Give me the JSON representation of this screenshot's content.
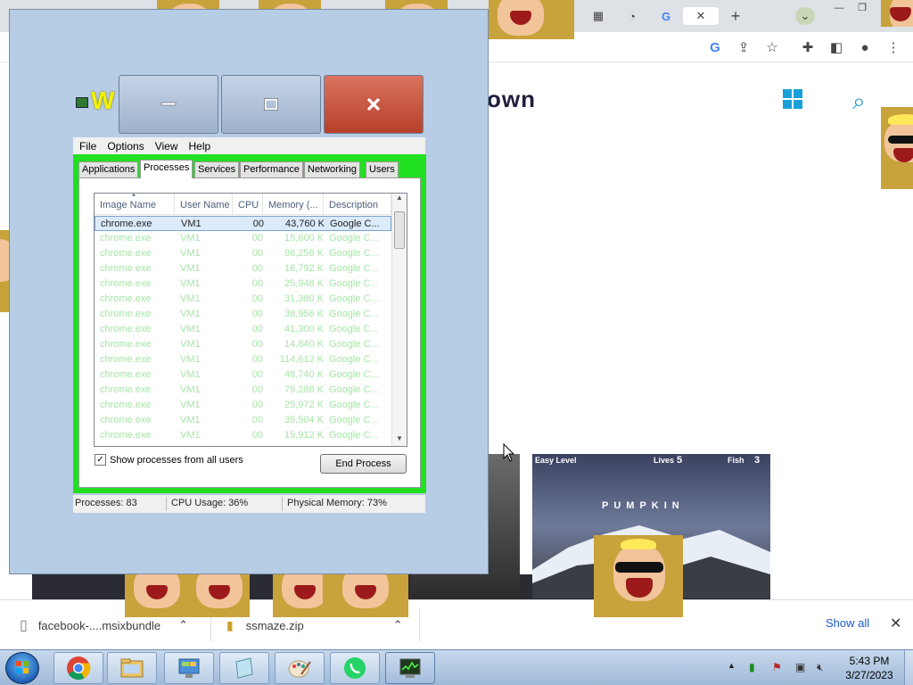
{
  "browser": {
    "site_brand": "own",
    "downloads": {
      "items": [
        {
          "name": "facebook-....msixbundle"
        },
        {
          "name": "ssmaze.zip"
        }
      ],
      "show_all": "Show all"
    },
    "game": {
      "level_label": "Easy  Level",
      "lives_label": "Lives",
      "lives_value": "5",
      "fish_label": "Fish",
      "fish_value": "3",
      "word": "PUMPKIN"
    }
  },
  "task_manager": {
    "title": "W",
    "menu": [
      "File",
      "Options",
      "View",
      "Help"
    ],
    "tabs": [
      "Applications",
      "Processes",
      "Services",
      "Performance",
      "Networking",
      "Users"
    ],
    "active_tab": "Processes",
    "columns": [
      "Image Name",
      "User Name",
      "CPU",
      "Memory (...",
      "Description"
    ],
    "rows": [
      {
        "image": "chrome.exe",
        "user": "VM1",
        "cpu": "00",
        "memory": "43,760 K",
        "desc": "Google C..."
      },
      {
        "image": "chrome.exe",
        "user": "VM1",
        "cpu": "00",
        "memory": "15,600 K",
        "desc": "Google C..."
      },
      {
        "image": "chrome.exe",
        "user": "VM1",
        "cpu": "00",
        "memory": "86,256 K",
        "desc": "Google C..."
      },
      {
        "image": "chrome.exe",
        "user": "VM1",
        "cpu": "00",
        "memory": "16,792 K",
        "desc": "Google C..."
      },
      {
        "image": "chrome.exe",
        "user": "VM1",
        "cpu": "00",
        "memory": "25,948 K",
        "desc": "Google C..."
      },
      {
        "image": "chrome.exe",
        "user": "VM1",
        "cpu": "00",
        "memory": "31,380 K",
        "desc": "Google C..."
      },
      {
        "image": "chrome.exe",
        "user": "VM1",
        "cpu": "00",
        "memory": "38,956 K",
        "desc": "Google C..."
      },
      {
        "image": "chrome.exe",
        "user": "VM1",
        "cpu": "00",
        "memory": "41,300 K",
        "desc": "Google C..."
      },
      {
        "image": "chrome.exe",
        "user": "VM1",
        "cpu": "00",
        "memory": "14,840 K",
        "desc": "Google C..."
      },
      {
        "image": "chrome.exe",
        "user": "VM1",
        "cpu": "00",
        "memory": "114,612 K",
        "desc": "Google C..."
      },
      {
        "image": "chrome.exe",
        "user": "VM1",
        "cpu": "00",
        "memory": "48,740 K",
        "desc": "Google C..."
      },
      {
        "image": "chrome.exe",
        "user": "VM1",
        "cpu": "00",
        "memory": "79,288 K",
        "desc": "Google C..."
      },
      {
        "image": "chrome.exe",
        "user": "VM1",
        "cpu": "00",
        "memory": "25,972 K",
        "desc": "Google C..."
      },
      {
        "image": "chrome.exe",
        "user": "VM1",
        "cpu": "00",
        "memory": "35,504 K",
        "desc": "Google C..."
      },
      {
        "image": "chrome.exe",
        "user": "VM1",
        "cpu": "00",
        "memory": "15,912 K",
        "desc": "Google C..."
      }
    ],
    "show_all_label": "Show processes from all users",
    "show_all_checked": true,
    "end_process_label": "End Process",
    "status": {
      "processes": "Processes: 83",
      "cpu": "CPU Usage: 36%",
      "memory": "Physical Memory: 73%"
    }
  },
  "taskbar": {
    "time": "5:43 PM",
    "date": "3/27/2023",
    "apps": [
      "chrome-icon",
      "explorer-icon",
      "control-panel-icon",
      "notepad-icon",
      "paint-icon",
      "whatsapp-icon",
      "task-manager-icon"
    ]
  },
  "colors": {
    "green_frame": "#21e021",
    "close_button": "#b7402a",
    "title_yellow": "#f2f200"
  }
}
